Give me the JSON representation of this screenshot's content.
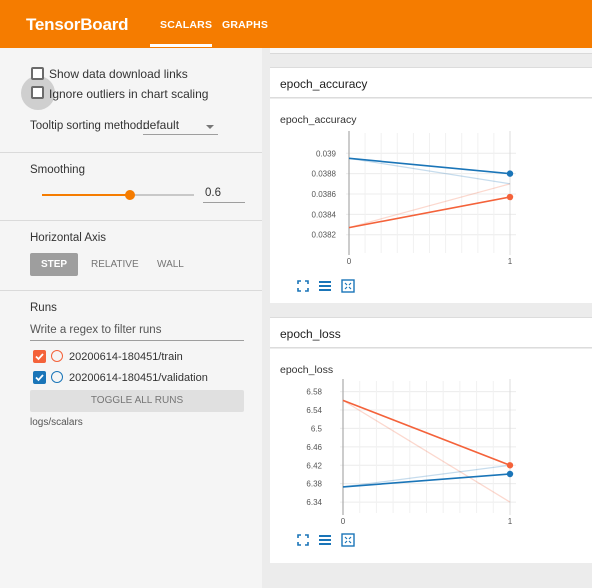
{
  "app": {
    "brand": "TensorBoard",
    "tabs": [
      {
        "label": "SCALARS",
        "active": true
      },
      {
        "label": "GRAPHS",
        "active": false
      }
    ],
    "accent_color": "#f57c00"
  },
  "sidebar": {
    "show_download_links": {
      "label": "Show data download links",
      "checked": false
    },
    "ignore_outliers": {
      "label": "Ignore outliers in chart scaling",
      "checked": false
    },
    "tooltip": {
      "label": "Tooltip sorting method:",
      "value": "default"
    },
    "smoothing": {
      "label": "Smoothing",
      "value": "0.6",
      "fraction": 0.6
    },
    "horizontal_axis": {
      "label": "Horizontal Axis",
      "options": [
        {
          "label": "STEP",
          "selected": true
        },
        {
          "label": "RELATIVE",
          "selected": false
        },
        {
          "label": "WALL",
          "selected": false
        }
      ]
    },
    "runs": {
      "label": "Runs",
      "filter_placeholder": "Write a regex to filter runs",
      "items": [
        {
          "name": "20200614-180451/train",
          "color": "#f4623a",
          "checked": true
        },
        {
          "name": "20200614-180451/validation",
          "color": "#1a75b8",
          "checked": true
        }
      ],
      "toggle_label": "TOGGLE ALL RUNS",
      "logdir": "logs/scalars"
    }
  },
  "groups": [
    {
      "title": "epoch_accuracy",
      "card_title": "epoch_accuracy",
      "chart_data": {
        "type": "line",
        "xlim": [
          0,
          1
        ],
        "ylim": [
          0.03806,
          0.03914
        ],
        "x_ticks": [
          "0",
          "1"
        ],
        "y_ticks": [
          {
            "label": "0.039",
            "value": 0.039
          },
          {
            "label": "0.0388",
            "value": 0.0388
          },
          {
            "label": "0.0386",
            "value": 0.0386
          },
          {
            "label": "0.0384",
            "value": 0.0384
          },
          {
            "label": "0.0382",
            "value": 0.0382
          }
        ],
        "series": [
          {
            "color": "#f4623a",
            "x": [
              0,
              1
            ],
            "y": [
              0.03827,
              0.03857
            ],
            "raw_y": [
              0.03827,
              0.0387
            ]
          },
          {
            "color": "#1a75b8",
            "x": [
              0,
              1
            ],
            "y": [
              0.03895,
              0.0388
            ],
            "raw_y": [
              0.03895,
              0.0387
            ]
          }
        ],
        "grid": true
      }
    },
    {
      "title": "epoch_loss",
      "card_title": "epoch_loss",
      "chart_data": {
        "type": "line",
        "xlim": [
          0,
          1
        ],
        "ylim": [
          6.325,
          6.59
        ],
        "x_ticks": [
          "0",
          "1"
        ],
        "y_ticks": [
          {
            "label": "6.58",
            "value": 6.58
          },
          {
            "label": "6.54",
            "value": 6.54
          },
          {
            "label": "6.5",
            "value": 6.5
          },
          {
            "label": "6.46",
            "value": 6.46
          },
          {
            "label": "6.42",
            "value": 6.42
          },
          {
            "label": "6.38",
            "value": 6.38
          },
          {
            "label": "6.34",
            "value": 6.34
          }
        ],
        "series": [
          {
            "color": "#f4623a",
            "x": [
              0,
              1
            ],
            "y": [
              6.561,
              6.42
            ],
            "raw_y": [
              6.561,
              6.34
            ]
          },
          {
            "color": "#1a75b8",
            "x": [
              0,
              1
            ],
            "y": [
              6.373,
              6.401
            ],
            "raw_y": [
              6.373,
              6.42
            ]
          }
        ],
        "grid": true
      }
    }
  ],
  "card_icons": [
    "fullscreen-icon",
    "data-table-icon",
    "fit-domain-icon"
  ]
}
